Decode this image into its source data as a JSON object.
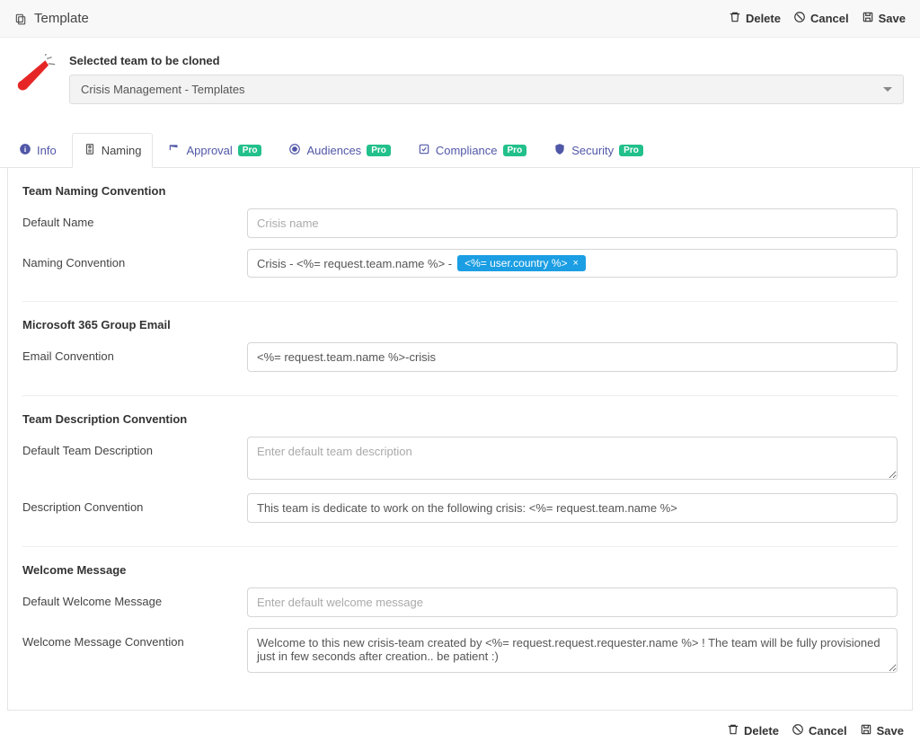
{
  "header": {
    "title": "Template",
    "actions": {
      "delete": "Delete",
      "cancel": "Cancel",
      "save": "Save"
    }
  },
  "teamSelect": {
    "label": "Selected team to be cloned",
    "value": "Crisis Management - Templates"
  },
  "tabs": {
    "info": "Info",
    "naming": "Naming",
    "approval": "Approval",
    "audiences": "Audiences",
    "compliance": "Compliance",
    "security": "Security",
    "proBadge": "Pro"
  },
  "sections": {
    "naming": {
      "title": "Team Naming Convention",
      "defaultNameLabel": "Default Name",
      "defaultNamePlaceholder": "Crisis name",
      "defaultNameValue": "",
      "conventionLabel": "Naming Convention",
      "conventionPrefix": "Crisis - <%= request.team.name %> -",
      "conventionToken": "<%= user.country %>"
    },
    "email": {
      "title": "Microsoft 365 Group Email",
      "conventionLabel": "Email Convention",
      "conventionValue": "<%= request.team.name %>-crisis"
    },
    "description": {
      "title": "Team Description Convention",
      "defaultLabel": "Default Team Description",
      "defaultPlaceholder": "Enter default team description",
      "conventionLabel": "Description Convention",
      "conventionValue": "This team is dedicate to work on the following crisis: <%= request.team.name %>"
    },
    "welcome": {
      "title": "Welcome Message",
      "defaultLabel": "Default Welcome Message",
      "defaultPlaceholder": "Enter default welcome message",
      "conventionLabel": "Welcome Message Convention",
      "conventionValue": "Welcome to this new crisis-team created by <%= request.request.requester.name %> ! The team will be fully provisioned just in few seconds after creation.. be patient :)"
    }
  },
  "footer": {
    "delete": "Delete",
    "cancel": "Cancel",
    "save": "Save"
  }
}
